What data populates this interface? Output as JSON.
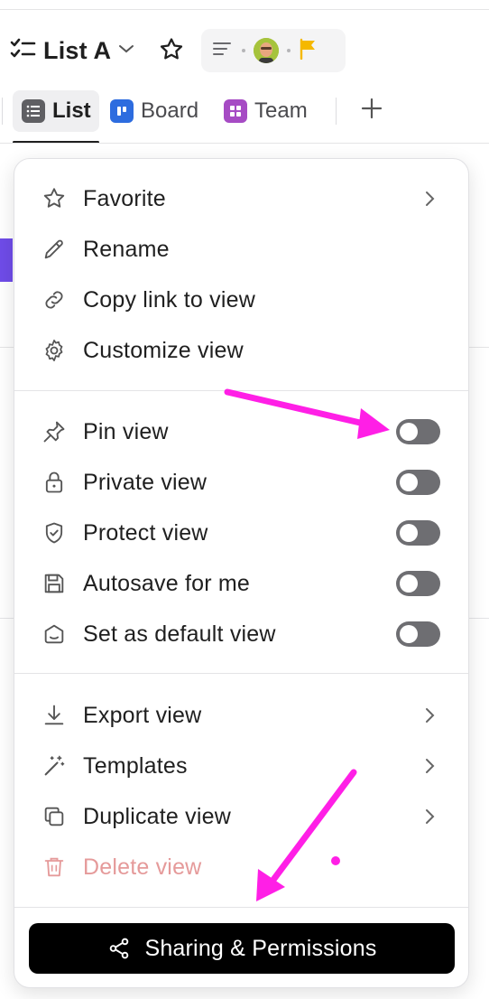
{
  "header": {
    "title": "List A",
    "title_icon": "checklist-icon",
    "favorite_icon": "star-icon"
  },
  "tabs": [
    {
      "label": "List",
      "icon": "list-icon",
      "color": "#5f5f63",
      "active": true
    },
    {
      "label": "Board",
      "icon": "board-icon",
      "color": "#2d6cdf"
    },
    {
      "label": "Team",
      "icon": "team-icon",
      "color": "#a64bc4"
    }
  ],
  "menu": {
    "group1": [
      {
        "label": "Favorite",
        "icon": "star-icon",
        "submenu": true
      },
      {
        "label": "Rename",
        "icon": "pencil-icon"
      },
      {
        "label": "Copy link to view",
        "icon": "link-icon"
      },
      {
        "label": "Customize view",
        "icon": "gear-icon"
      }
    ],
    "group2": [
      {
        "label": "Pin view",
        "icon": "pin-icon",
        "toggle": false
      },
      {
        "label": "Private view",
        "icon": "lock-icon",
        "toggle": false
      },
      {
        "label": "Protect view",
        "icon": "shield-icon",
        "toggle": false
      },
      {
        "label": "Autosave for me",
        "icon": "save-icon",
        "toggle": false
      },
      {
        "label": "Set as default view",
        "icon": "default-view-icon",
        "toggle": false
      }
    ],
    "group3": [
      {
        "label": "Export view",
        "icon": "download-icon",
        "submenu": true
      },
      {
        "label": "Templates",
        "icon": "magic-wand-icon",
        "submenu": true
      },
      {
        "label": "Duplicate view",
        "icon": "duplicate-icon",
        "submenu": true
      },
      {
        "label": "Delete view",
        "icon": "trash-icon",
        "danger": true
      }
    ],
    "share_button": "Sharing & Permissions"
  },
  "colors": {
    "annotation": "#ff1fe6",
    "flag": "#f5b800",
    "toggle_off": "#6e6e72",
    "danger": "#e59a9a"
  }
}
